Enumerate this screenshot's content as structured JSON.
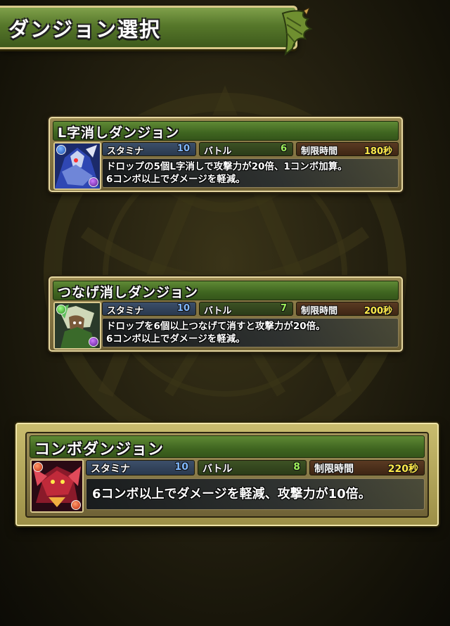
{
  "header": {
    "title": "ダンジョン選択"
  },
  "dungeons": [
    {
      "name": "L字消しダンジョン",
      "stamina_label": "スタミナ",
      "stamina": "10",
      "battle_label": "バトル",
      "battle": "6",
      "time_label": "制限時間",
      "time": "180秒",
      "description": "ドロップの5個L字消しで攻撃力が20倍、1コンボ加算。\n6コンボ以上でダメージを軽減。",
      "portrait_icon": "blue-armored-knight-monster-portrait",
      "selected": false
    },
    {
      "name": "つなげ消しダンジョン",
      "stamina_label": "スタミナ",
      "stamina": "10",
      "battle_label": "バトル",
      "battle": "7",
      "time_label": "制限時間",
      "time": "200秒",
      "description": "ドロップを6個以上つなげて消すと攻撃力が20倍。\n6コンボ以上でダメージを軽減。",
      "portrait_icon": "green-haired-warrior-monster-portrait",
      "selected": false
    },
    {
      "name": "コンボダンジョン",
      "stamina_label": "スタミナ",
      "stamina": "10",
      "battle_label": "バトル",
      "battle": "8",
      "time_label": "制限時間",
      "time": "220秒",
      "description": "6コンボ以上でダメージを軽減、攻撃力が10倍。",
      "portrait_icon": "red-dragon-monster-portrait",
      "selected": true
    }
  ],
  "colors": {
    "stamina_value": "#7fb7ff",
    "battle_value": "#9df05a",
    "time_value": "#ffe94a",
    "title_bar": "#4a7226",
    "frame_gold": "#d8c98a"
  }
}
